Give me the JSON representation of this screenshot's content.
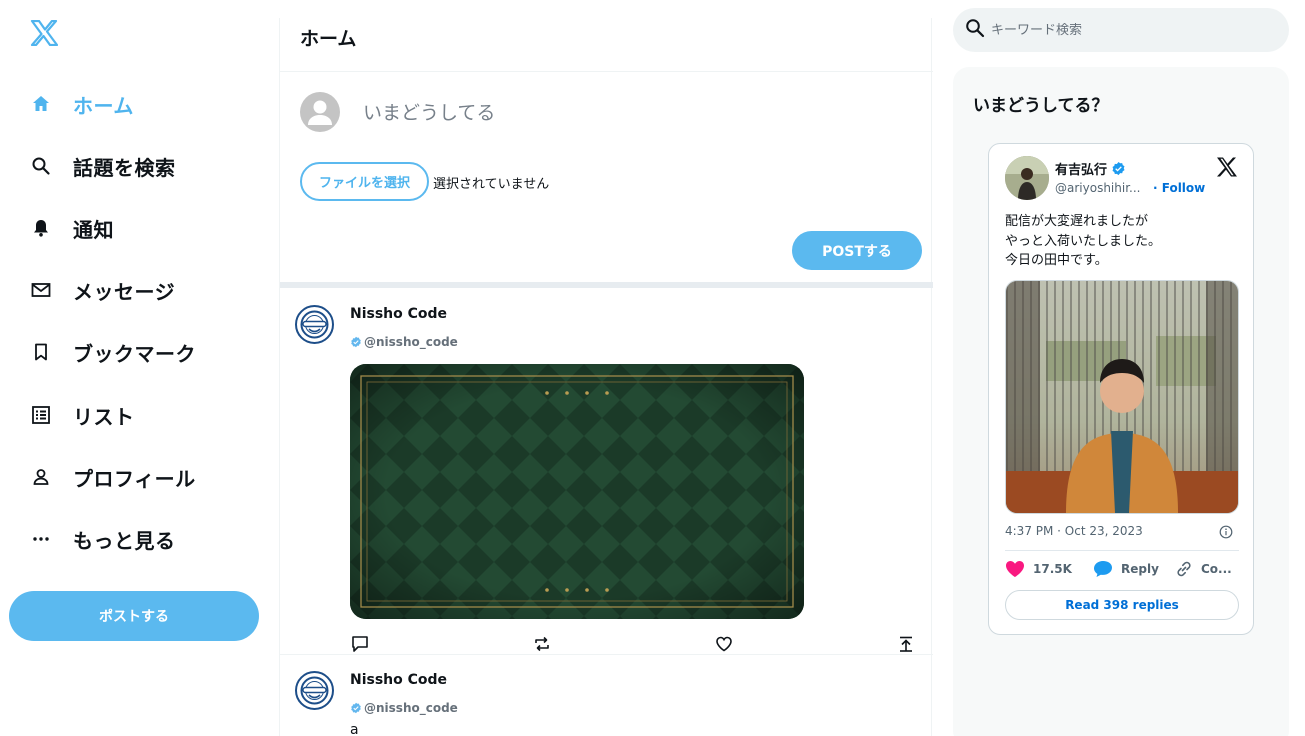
{
  "sidebar": {
    "logo": "x-logo-icon",
    "items": [
      {
        "label": "ホーム",
        "icon": "home-icon",
        "active": true
      },
      {
        "label": "話題を検索",
        "icon": "search-icon"
      },
      {
        "label": "通知",
        "icon": "bell-icon"
      },
      {
        "label": "メッセージ",
        "icon": "mail-icon"
      },
      {
        "label": "ブックマーク",
        "icon": "bookmark-icon"
      },
      {
        "label": "リスト",
        "icon": "list-icon"
      },
      {
        "label": "プロフィール",
        "icon": "user-icon"
      },
      {
        "label": "もっと見る",
        "icon": "more-icon"
      }
    ],
    "post_label": "ポストする"
  },
  "main": {
    "title": "ホーム",
    "compose": {
      "placeholder": "いまどうしてる",
      "file_button": "ファイルを選択",
      "file_status": "選択されていません",
      "post_button": "POSTする"
    },
    "posts": [
      {
        "name": "Nissho Code",
        "handle": "@nissho_code",
        "has_image": true,
        "text": ""
      },
      {
        "name": "Nissho Code",
        "handle": "@nissho_code",
        "has_image": false,
        "text": "a"
      }
    ]
  },
  "right": {
    "search_placeholder": "キーワード検索",
    "panel_title": "いまどうしてる？",
    "embed": {
      "name": "有吉弘行",
      "handle": "@ariyoshihir...",
      "follow": "· Follow",
      "lines": [
        "配信が大変遅れましたが",
        "やっと入荷いたしました。",
        "今日の田中です。"
      ],
      "time": "4:37 PM · Oct 23, 2023",
      "likes": "17.5K",
      "reply": "Reply",
      "copy": "Co...",
      "read_replies": "Read 398 replies"
    }
  },
  "colors": {
    "accent": "#5bb9ef",
    "accent_text": "#4fb4ee",
    "verified": "#1d9bf0",
    "like": "#f91880",
    "link": "#006fd6"
  }
}
